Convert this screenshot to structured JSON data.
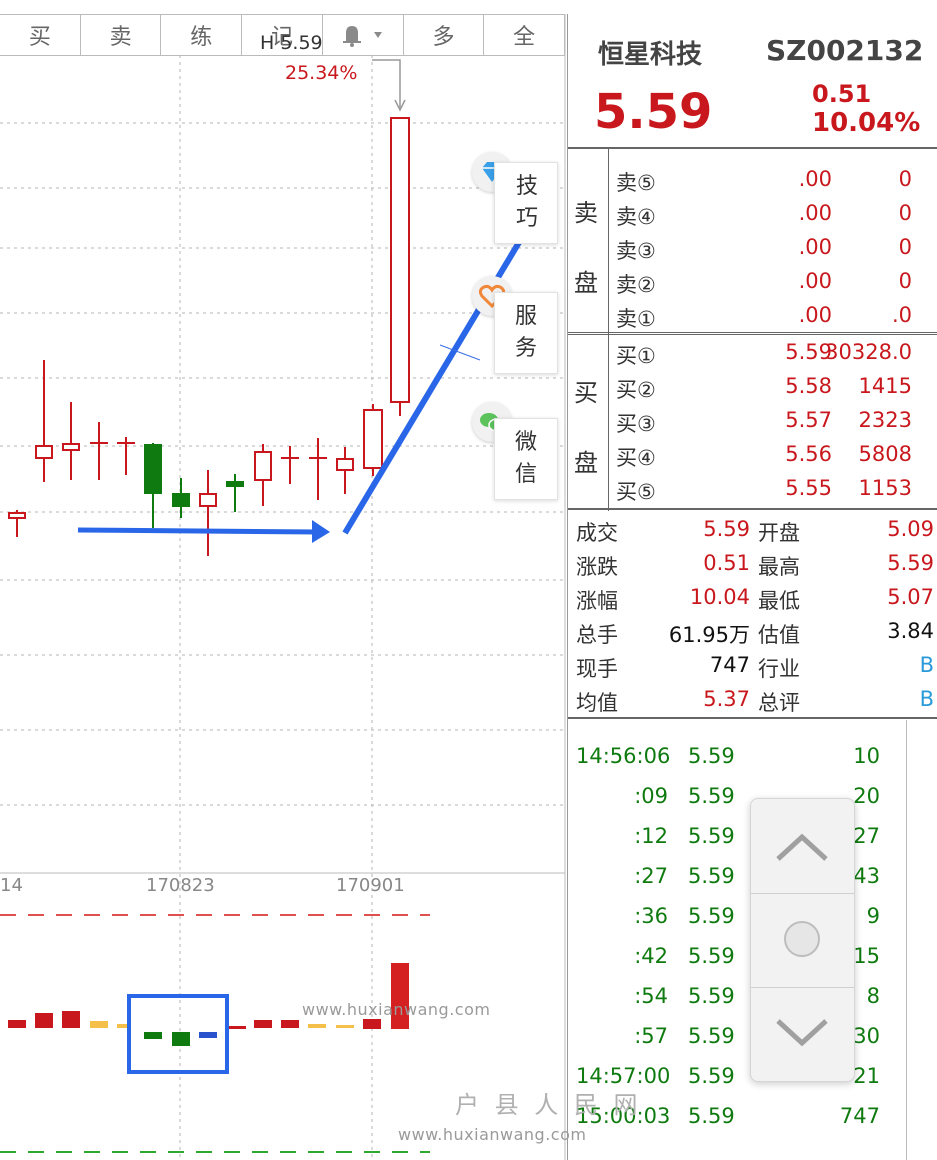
{
  "toolbar": {
    "tabs": [
      "买",
      "卖",
      "练",
      "记",
      "",
      "多",
      "全"
    ]
  },
  "chart": {
    "high_label": "H 5.59",
    "high_pct": "25.34%",
    "dates": [
      "14",
      "170823",
      "170901"
    ]
  },
  "side_buttons": {
    "tech_label": "技巧",
    "service_label": "服务",
    "wechat_label": "微信"
  },
  "quote": {
    "name": "恒星科技",
    "code": "SZ002132",
    "price": "5.59",
    "change": "0.51",
    "change_pct": "10.04%"
  },
  "order_book": {
    "sell_title": [
      "卖",
      "盘"
    ],
    "buy_title": [
      "买",
      "盘"
    ],
    "sell": [
      {
        "label": "卖⑤",
        "price": ".00",
        "vol": "0"
      },
      {
        "label": "卖④",
        "price": ".00",
        "vol": "0"
      },
      {
        "label": "卖③",
        "price": ".00",
        "vol": "0"
      },
      {
        "label": "卖②",
        "price": ".00",
        "vol": "0"
      },
      {
        "label": "卖①",
        "price": ".00",
        "vol": ".0"
      }
    ],
    "buy": [
      {
        "label": "买①",
        "price": "5.59",
        "vol": "30328.0"
      },
      {
        "label": "买②",
        "price": "5.58",
        "vol": "1415"
      },
      {
        "label": "买③",
        "price": "5.57",
        "vol": "2323"
      },
      {
        "label": "买④",
        "price": "5.56",
        "vol": "5808"
      },
      {
        "label": "买⑤",
        "price": "5.55",
        "vol": "1153"
      }
    ]
  },
  "stats": [
    {
      "l1": "成交",
      "v1": "5.59",
      "l2": "开盘",
      "v2": "5.09"
    },
    {
      "l1": "涨跌",
      "v1": "0.51",
      "l2": "最高",
      "v2": "5.59"
    },
    {
      "l1": "涨幅",
      "v1": "10.04",
      "l2": "最低",
      "v2": "5.07"
    },
    {
      "l1": "总手",
      "v1": "61.95万",
      "l2": "估值",
      "v2": "3.84"
    },
    {
      "l1": "现手",
      "v1": "747",
      "l2": "行业",
      "v2": "B"
    },
    {
      "l1": "均值",
      "v1": "5.37",
      "l2": "总评",
      "v2": "B"
    }
  ],
  "ticks": [
    {
      "time": "14:56:06",
      "price": "5.59",
      "vol": "10"
    },
    {
      "time": ":09",
      "price": "5.59",
      "vol": "20"
    },
    {
      "time": ":12",
      "price": "5.59",
      "vol": "27"
    },
    {
      "time": ":27",
      "price": "5.59",
      "vol": "43"
    },
    {
      "time": ":36",
      "price": "5.59",
      "vol": "9"
    },
    {
      "time": ":42",
      "price": "5.59",
      "vol": "15"
    },
    {
      "time": ":54",
      "price": "5.59",
      "vol": "8"
    },
    {
      "time": ":57",
      "price": "5.59",
      "vol": "30"
    },
    {
      "time": "14:57:00",
      "price": "5.59",
      "vol": "21"
    },
    {
      "time": "15:00:03",
      "price": "5.59",
      "vol": "747"
    }
  ],
  "watermarks": {
    "url1": "www.huxianwang.com",
    "cn": "户 县 人 民 网",
    "url2": "www.huxianwang.com"
  },
  "colors": {
    "up": "#c8181d",
    "down": "#0f7a0f",
    "arrow": "#2a67e8",
    "highlight_box": "#2a67e8"
  }
}
